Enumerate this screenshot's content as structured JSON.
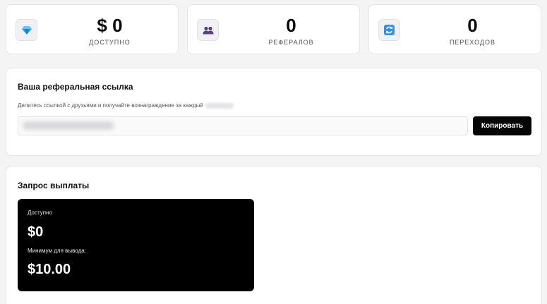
{
  "stats": [
    {
      "icon": "gem-icon",
      "value": "$ 0",
      "label": "ДОСТУПНО"
    },
    {
      "icon": "users-icon",
      "value": "0",
      "label": "РЕФЕРАЛОВ"
    },
    {
      "icon": "refresh-icon",
      "value": "0",
      "label": "ПЕРЕХОДОВ"
    }
  ],
  "referral": {
    "title": "Ваша реферальная ссылка",
    "description": "Делитесь ссылкой с друзьями и получайте вознаграждение за каждый",
    "link_value": "",
    "copy_label": "Копировать"
  },
  "payout": {
    "title": "Запрос выплаты",
    "available_label": "Доступно",
    "available_value": "$0",
    "minimum_label": "Минимум для вывода:",
    "minimum_value": "$10.00"
  },
  "colors": {
    "accent": "#000000",
    "gem": "#2b9be8",
    "users": "#5a3d8f",
    "refresh": "#3b8fd9"
  }
}
